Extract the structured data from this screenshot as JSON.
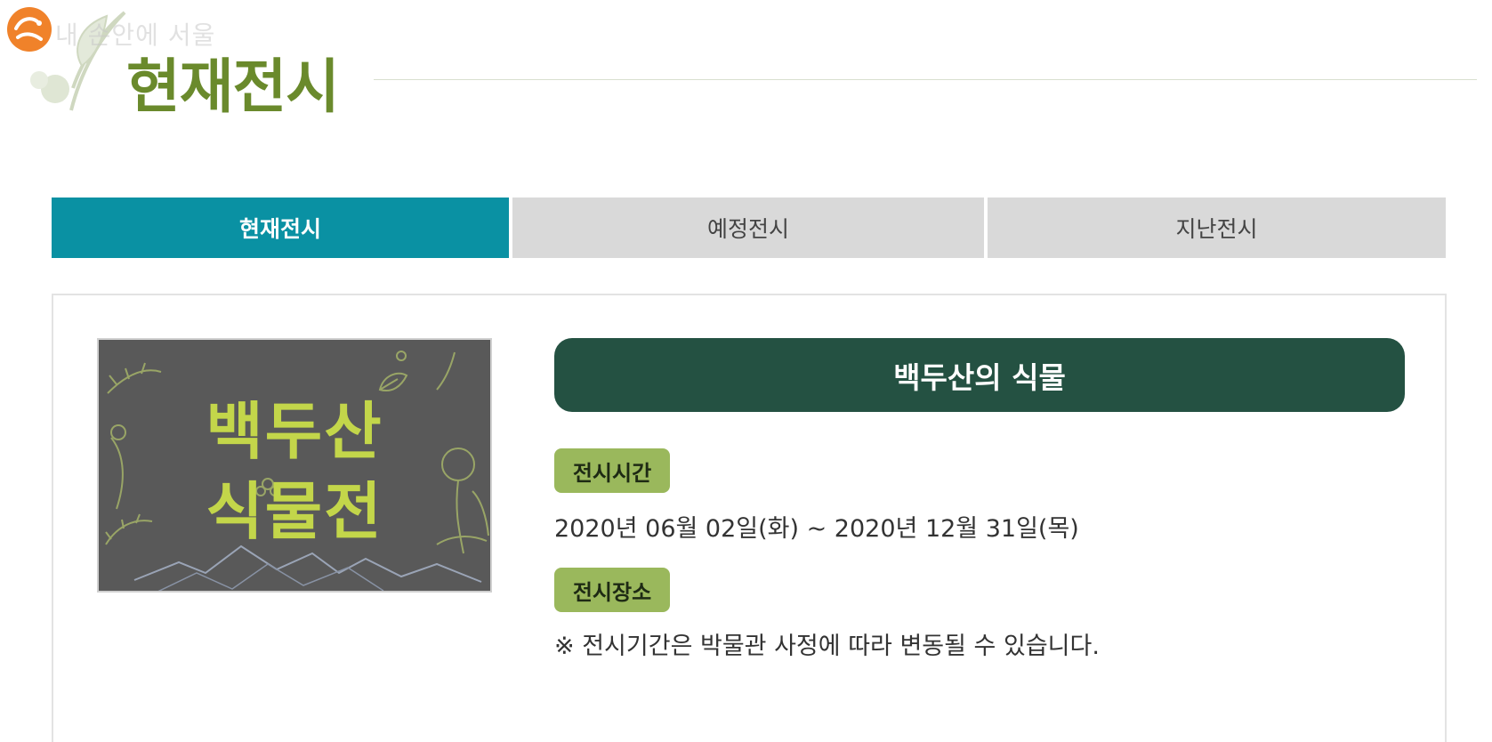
{
  "header": {
    "logo_text": "내 손안에 서울",
    "page_title": "현재전시"
  },
  "tabs": [
    {
      "label": "현재전시",
      "active": true
    },
    {
      "label": "예정전시",
      "active": false
    },
    {
      "label": "지난전시",
      "active": false
    }
  ],
  "exhibition": {
    "poster_line1": "백두산",
    "poster_line2": "식물전",
    "title": "백두산의 식물",
    "time_label": "전시시간",
    "time_value": "2020년 06월 02일(화) ~ 2020년 12월 31일(목)",
    "place_label": "전시장소",
    "place_value": "※ 전시기간은 박물관 사정에 따라 변동될 수 있습니다."
  },
  "colors": {
    "title_green": "#6a8a2c",
    "tab_active": "#0a91a3",
    "tab_inactive": "#d9d9d9",
    "exhibit_header": "#245142",
    "badge": "#9ab85c",
    "poster_bg": "#595959",
    "poster_text": "#c3d64a"
  }
}
